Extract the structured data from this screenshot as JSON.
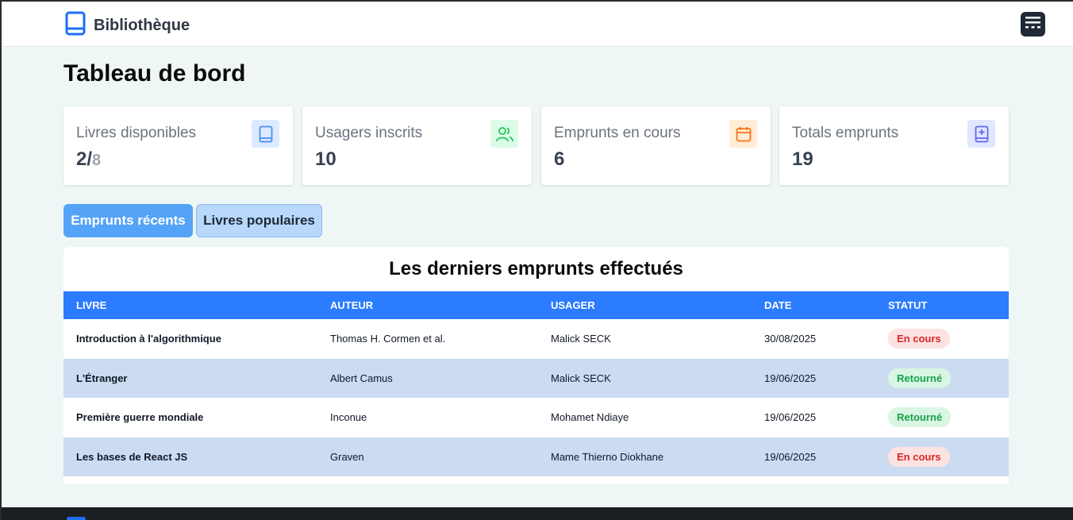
{
  "header": {
    "brand_title": "Bibliothèque",
    "brand_icon": "book-icon",
    "menu_icon": "menu-icon"
  },
  "page": {
    "title": "Tableau de bord"
  },
  "stats": [
    {
      "label": "Livres disponibles",
      "value": "2/",
      "value_secondary": "8",
      "icon": "book-icon",
      "icon_bg": "#dbeafe",
      "icon_color": "#4b8ff0"
    },
    {
      "label": "Usagers inscrits",
      "value": "10",
      "icon": "users-icon",
      "icon_bg": "#dcfce7",
      "icon_color": "#22c55e"
    },
    {
      "label": "Emprunts en cours",
      "value": "6",
      "icon": "calendar-icon",
      "icon_bg": "#ffedd5",
      "icon_color": "#f97316"
    },
    {
      "label": "Totals emprunts",
      "value": "19",
      "icon": "book-plus-icon",
      "icon_bg": "#e0e7ff",
      "icon_color": "#6366f1"
    }
  ],
  "tabs": [
    {
      "label": "Emprunts récents",
      "active": true
    },
    {
      "label": "Livres populaires",
      "active": false
    }
  ],
  "recent_loans": {
    "title": "Les derniers emprunts effectués",
    "columns": [
      "LIVRE",
      "AUTEUR",
      "USAGER",
      "DATE",
      "STATUT"
    ],
    "rows": [
      {
        "book": "Introduction à l'algorithmique",
        "author": "Thomas H. Cormen et al.",
        "user": "Malick SECK",
        "date": "30/08/2025",
        "status": "En cours",
        "status_type": "ongoing"
      },
      {
        "book": "L'Étranger",
        "author": "Albert Camus",
        "user": "Malick SECK",
        "date": "19/06/2025",
        "status": "Retourné",
        "status_type": "returned"
      },
      {
        "book": "Première guerre mondiale",
        "author": "Inconue",
        "user": "Mohamet Ndiaye",
        "date": "19/06/2025",
        "status": "Retourné",
        "status_type": "returned"
      },
      {
        "book": "Les bases de React JS",
        "author": "Graven",
        "user": "Mame Thierno Diokhane",
        "date": "19/06/2025",
        "status": "En cours",
        "status_type": "ongoing"
      }
    ]
  },
  "colors": {
    "accent": "#2b7cff",
    "tab_active": "#54a3f7",
    "status_ongoing": "#dc2626",
    "status_returned": "#16a34a"
  }
}
